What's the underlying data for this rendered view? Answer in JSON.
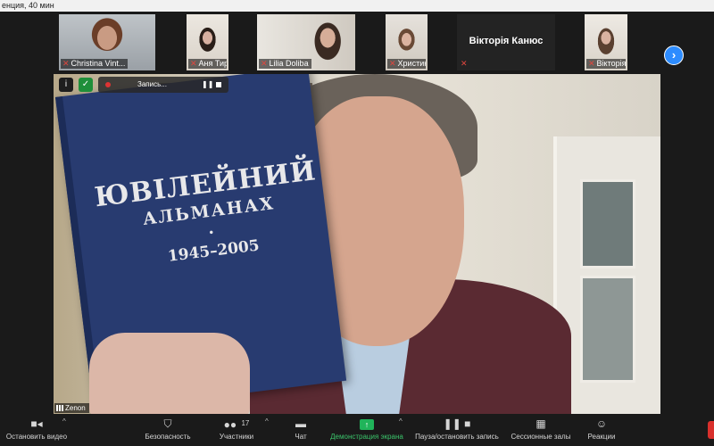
{
  "window": {
    "title": "енция, 40 мин"
  },
  "thumbnails": [
    {
      "name": "Christina Vint...",
      "muted": true,
      "type": "video"
    },
    {
      "name": "Аня Тирлич",
      "muted": true,
      "type": "video"
    },
    {
      "name": "Lilia Doliba",
      "muted": true,
      "type": "video"
    },
    {
      "name": "Христина Ку...",
      "muted": true,
      "type": "video"
    },
    {
      "name": "Вікторія Канюс",
      "muted": true,
      "type": "text"
    },
    {
      "name": "Вікторія Рош...",
      "muted": true,
      "type": "video"
    }
  ],
  "recording": {
    "label": "Запись..."
  },
  "book": {
    "line1": "ЮВІЛЕЙНИЙ",
    "line2": "АЛЬМАНАХ",
    "dot": "•",
    "line3": "1945–2005"
  },
  "speaker": {
    "name": "Zenon"
  },
  "toolbar": {
    "stop_video": "Остановить видео",
    "security": "Безопасность",
    "participants": "Участники",
    "participants_count": "17",
    "chat": "Чат",
    "share_screen": "Демонстрация экрана",
    "pause_recording": "Пауза/остановить запись",
    "breakout_rooms": "Сессионные залы",
    "reactions": "Реакции"
  },
  "colors": {
    "accent_blue": "#2d8cff",
    "share_green": "#3bc46b",
    "end_red": "#d9302c",
    "mute_red": "#e0463e"
  }
}
